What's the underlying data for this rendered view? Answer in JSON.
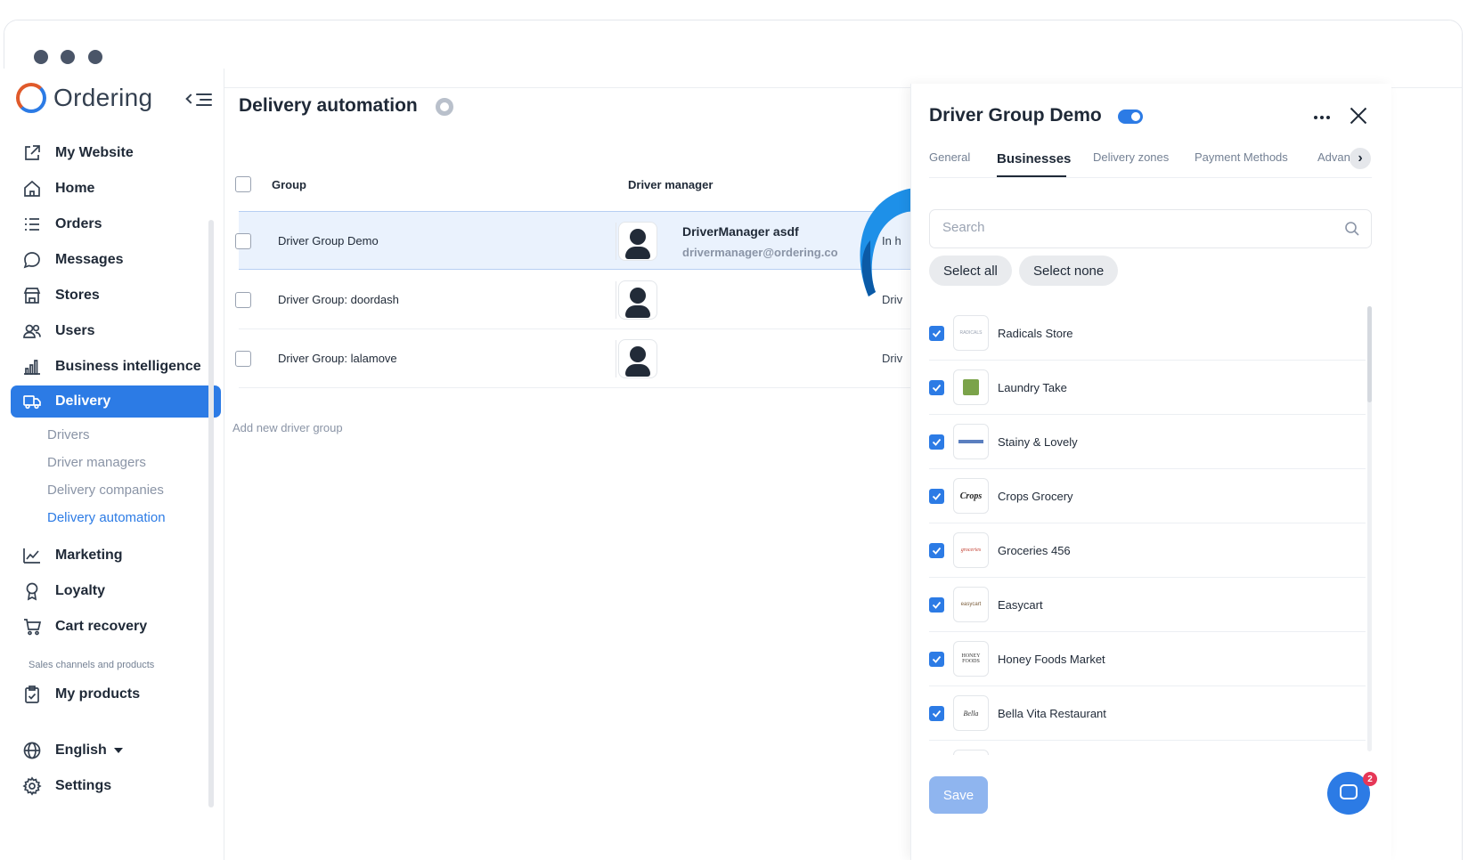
{
  "app": {
    "logo_text": "Ordering"
  },
  "sidebar": {
    "items": [
      {
        "label": "My Website",
        "icon": "external-link-icon"
      },
      {
        "label": "Home",
        "icon": "home-icon"
      },
      {
        "label": "Orders",
        "icon": "list-icon"
      },
      {
        "label": "Messages",
        "icon": "chat-icon"
      },
      {
        "label": "Stores",
        "icon": "store-icon"
      },
      {
        "label": "Users",
        "icon": "users-icon"
      },
      {
        "label": "Business intelligence",
        "icon": "bar-chart-icon"
      },
      {
        "label": "Delivery",
        "icon": "truck-icon"
      },
      {
        "label": "Marketing",
        "icon": "line-chart-icon"
      },
      {
        "label": "Loyalty",
        "icon": "award-icon"
      },
      {
        "label": "Cart recovery",
        "icon": "cart-icon"
      },
      {
        "label": "My products",
        "icon": "clipboard-check-icon"
      },
      {
        "label": "English",
        "icon": "globe-icon"
      },
      {
        "label": "Settings",
        "icon": "gear-icon"
      }
    ],
    "delivery_sub": [
      "Drivers",
      "Driver managers",
      "Delivery companies",
      "Delivery automation"
    ],
    "section_label": "Sales channels and products"
  },
  "main": {
    "title": "Delivery automation",
    "columns": {
      "group": "Group",
      "driver_manager": "Driver manager"
    },
    "rows": [
      {
        "name": "Driver Group Demo",
        "manager_name": "DriverManager asdf",
        "manager_email": "drivermanager@ordering.co",
        "col3": "In h"
      },
      {
        "name": "Driver Group: doordash",
        "manager_name": "",
        "manager_email": "",
        "col3": "Driv"
      },
      {
        "name": "Driver Group: lalamove",
        "manager_name": "",
        "manager_email": "",
        "col3": "Driv"
      }
    ],
    "add_group": "Add new driver group"
  },
  "panel": {
    "title": "Driver Group Demo",
    "tabs": [
      "General",
      "Businesses",
      "Delivery zones",
      "Payment Methods",
      "Advan"
    ],
    "search_placeholder": "Search",
    "select_all": "Select all",
    "select_none": "Select none",
    "businesses": [
      {
        "name": "Radicals Store",
        "logo_text": "RADICALS"
      },
      {
        "name": "Laundry Take",
        "logo_text": ""
      },
      {
        "name": "Stainy & Lovely",
        "logo_text": ""
      },
      {
        "name": "Crops Grocery",
        "logo_text": "Crops"
      },
      {
        "name": "Groceries 456",
        "logo_text": "groceries"
      },
      {
        "name": "Easycart",
        "logo_text": "easycart"
      },
      {
        "name": "Honey Foods Market",
        "logo_text": "HONEY FOODS"
      },
      {
        "name": "Bella Vita Restaurant",
        "logo_text": "Bella"
      }
    ],
    "save_label": "Save"
  },
  "chat": {
    "badge": "2"
  },
  "colors": {
    "accent": "#2C7BE5",
    "arrow": "#1E90E8"
  }
}
